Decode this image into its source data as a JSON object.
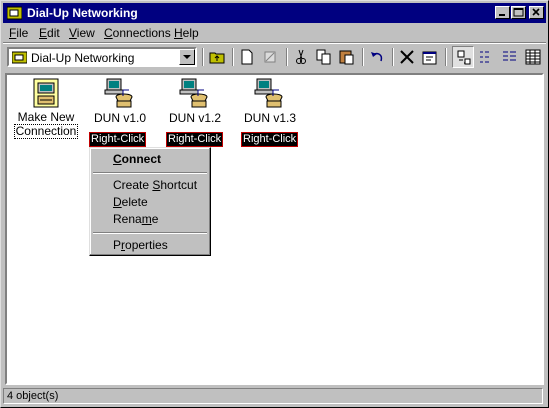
{
  "window": {
    "title": "Dial-Up Networking"
  },
  "menubar": [
    {
      "pre": "",
      "key": "F",
      "post": "ile"
    },
    {
      "pre": "",
      "key": "E",
      "post": "dit"
    },
    {
      "pre": "",
      "key": "V",
      "post": "iew"
    },
    {
      "pre": "",
      "key": "C",
      "post": "onnections"
    },
    {
      "pre": "",
      "key": "H",
      "post": "elp"
    }
  ],
  "toolbar": {
    "address_value": "Dial-Up Networking"
  },
  "icons": [
    {
      "line1": "Make New",
      "line2": "Connection"
    },
    {
      "line1": "DUN v1.0",
      "tag": "Right-Click"
    },
    {
      "line1": "DUN v1.2",
      "tag": "Right-Click"
    },
    {
      "line1": "DUN v1.3",
      "tag": "Right-Click"
    }
  ],
  "context_menu": {
    "connect": {
      "pre": "",
      "key": "C",
      "post": "onnect"
    },
    "create_shortcut": {
      "pre": "Create ",
      "key": "S",
      "post": "hortcut"
    },
    "delete": {
      "pre": "",
      "key": "D",
      "post": "elete"
    },
    "rename": {
      "pre": "Rena",
      "key": "m",
      "post": "e"
    },
    "properties": {
      "pre": "P",
      "key": "r",
      "post": "operties"
    }
  },
  "status": {
    "text": "4 object(s)"
  },
  "colors": {
    "titlebar": "#000080",
    "face": "#c0c0c0",
    "tag_border": "#c00000"
  }
}
